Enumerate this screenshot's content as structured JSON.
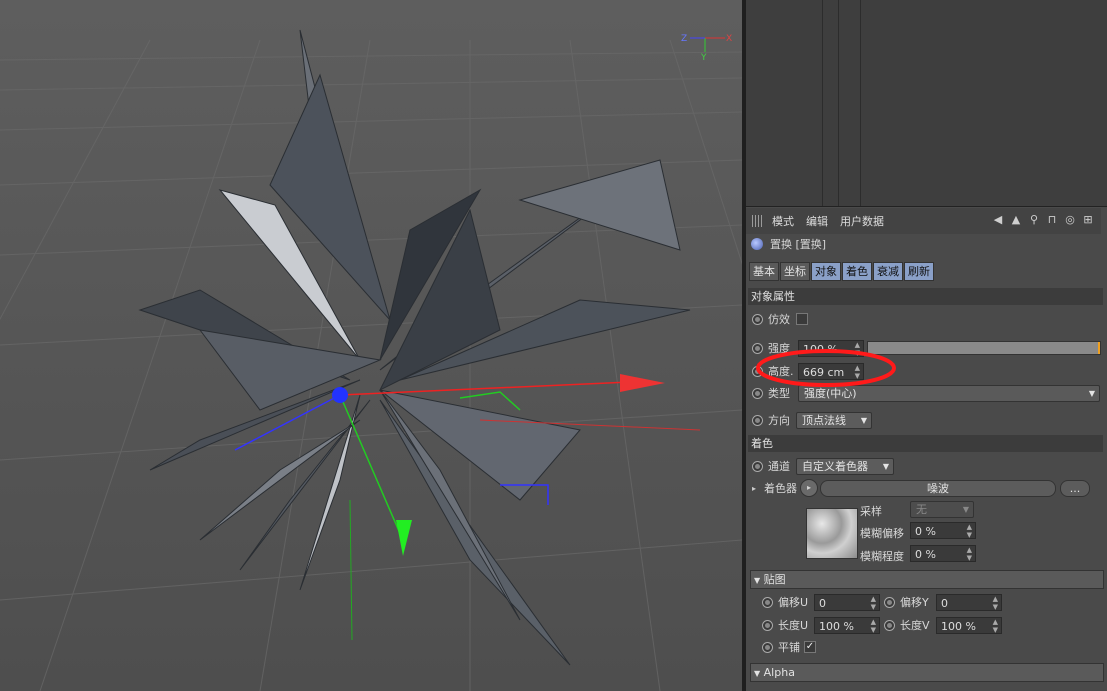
{
  "viewport": {
    "axis_gizmo": {
      "z": "Z",
      "x": "X",
      "y": "Y"
    }
  },
  "attributes": {
    "menu": [
      "模式",
      "编辑",
      "用户数据"
    ],
    "toolbar_icons": [
      "arrow-left-icon",
      "arrow-up-icon",
      "search-icon",
      "lock-icon",
      "target-icon",
      "new-panel-icon"
    ],
    "object_title": "置换 [置换]",
    "tabs": [
      {
        "label": "基本",
        "active": false
      },
      {
        "label": "坐标",
        "active": false
      },
      {
        "label": "对象",
        "active": true
      },
      {
        "label": "着色",
        "active": true
      },
      {
        "label": "衰减",
        "active": true
      },
      {
        "label": "刷新",
        "active": true
      }
    ],
    "object_section": "对象属性",
    "fake_effect_label": "仿效",
    "strength_label": "强度",
    "strength_value": "100 %",
    "strength_fraction": 1.0,
    "height_label": "高度.",
    "height_value": "669 cm",
    "type_label": "类型",
    "type_value": "强度(中心)",
    "direction_label": "方向",
    "direction_value": "顶点法线",
    "shading_section": "着色",
    "channel_label": "通道",
    "channel_value": "自定义着色器",
    "shader_label": "着色器",
    "shader_value": "噪波",
    "shader_more": "...",
    "sampling_label": "采样",
    "sampling_value": "无",
    "blur_offset_label": "模糊偏移",
    "blur_offset_value": "0 %",
    "blur_scale_label": "模糊程度",
    "blur_scale_value": "0 %",
    "mapping_section": "贴图",
    "offset_u_label": "偏移U",
    "offset_u_value": "0",
    "offset_v_label": "偏移Y",
    "offset_v_value": "0",
    "length_u_label": "长度U",
    "length_u_value": "100 %",
    "length_v_label": "长度V",
    "length_v_value": "100 %",
    "tile_label": "平铺",
    "tile_checked": "✓",
    "alpha_section": "Alpha",
    "annotation_color": "#ff1a1a"
  }
}
